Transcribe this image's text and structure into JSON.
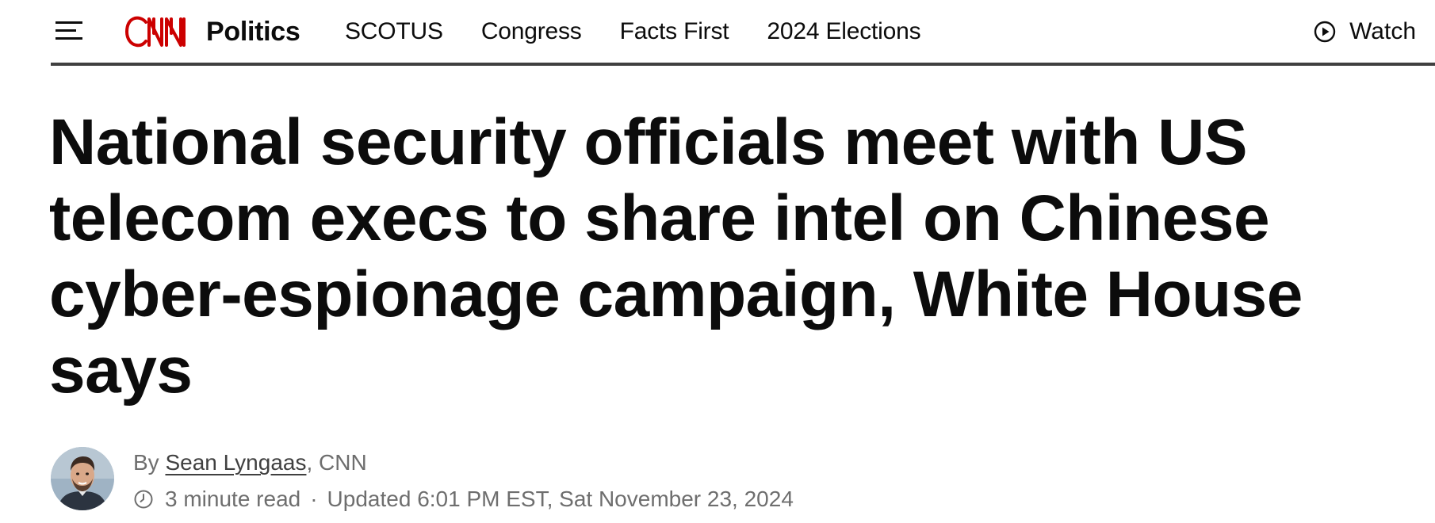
{
  "header": {
    "logo_text": "CNN",
    "section_name": "Politics",
    "nav": [
      {
        "label": "SCOTUS"
      },
      {
        "label": "Congress"
      },
      {
        "label": "Facts First"
      },
      {
        "label": "2024 Elections"
      }
    ],
    "watch_label": "Watch",
    "icons": {
      "menu": "hamburger-menu-icon",
      "watch": "play-circle-icon"
    },
    "colors": {
      "brand_red": "#cc0000",
      "text": "#0c0c0c",
      "rule": "#404040"
    }
  },
  "article": {
    "headline": "National security officials meet with US telecom execs to share intel on Chinese cyber-espionage campaign, White House says",
    "byline": {
      "prefix": "By",
      "author": "Sean Lyngaas",
      "separator": ",",
      "outlet": "CNN"
    },
    "meta": {
      "read_time": "3 minute read",
      "separator": "·",
      "updated": "Updated 6:01 PM EST, Sat November 23, 2024"
    },
    "icons": {
      "clock": "clock-icon",
      "avatar": "author-avatar"
    },
    "colors": {
      "meta_text": "#6e6e6e"
    }
  }
}
